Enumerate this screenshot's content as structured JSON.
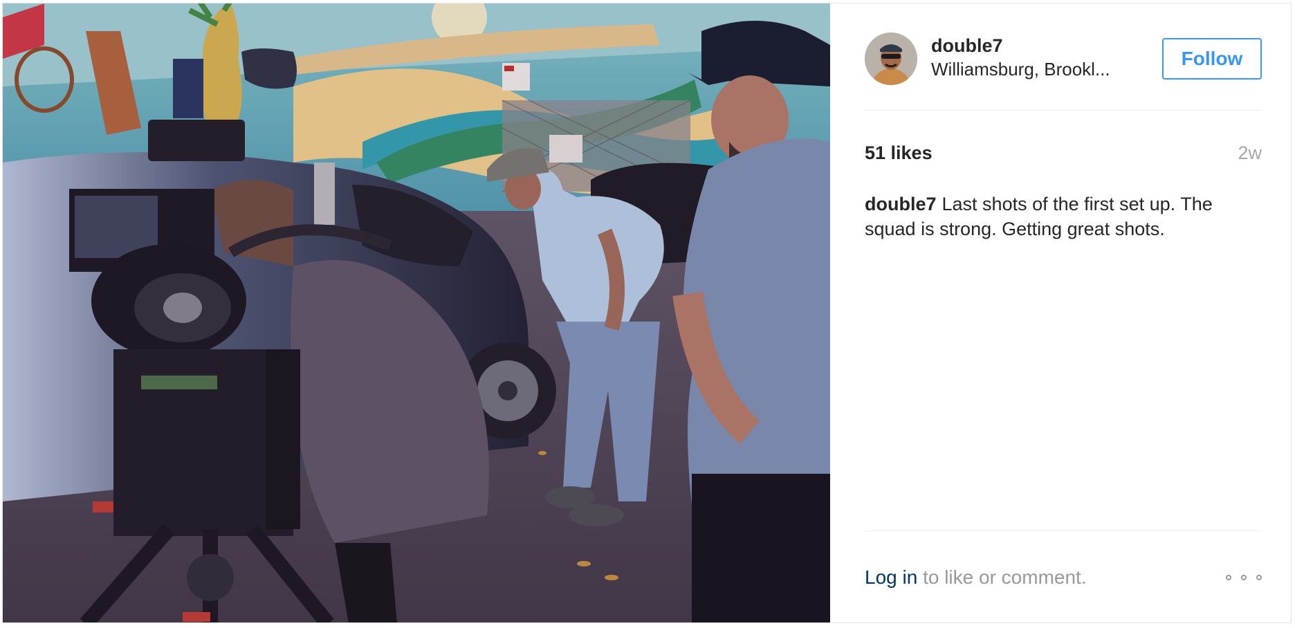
{
  "post": {
    "image": {
      "description_icon": "photo-icon"
    },
    "header": {
      "username": "double7",
      "location": "Williamsburg, Brookl...",
      "follow_label": "Follow"
    },
    "likes_label": "51 likes",
    "time_ago": "2w",
    "caption": {
      "username": "double7",
      "text": "Last shots of the first set up. The squad is strong. Getting great shots."
    },
    "footer": {
      "login_label": "Log in",
      "login_suffix": " to like or comment.",
      "more_icon": "more-options-icon"
    }
  },
  "colors": {
    "accent": "#3897f0",
    "link": "#003569",
    "text": "#262626",
    "muted": "#999999"
  }
}
